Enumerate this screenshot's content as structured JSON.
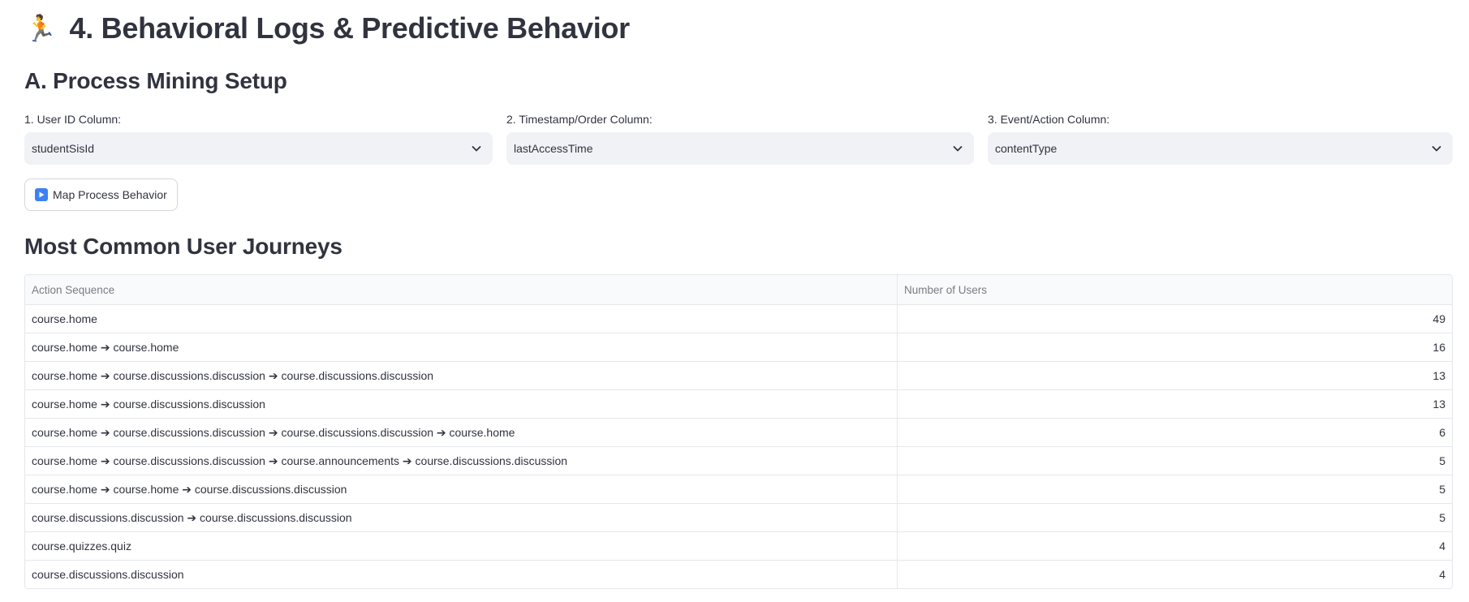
{
  "header": {
    "icon": "person-walking-icon",
    "emoji": "🏃",
    "title": "4. Behavioral Logs & Predictive Behavior"
  },
  "setup": {
    "section_title": "A. Process Mining Setup",
    "fields": [
      {
        "label": "1. User ID Column:",
        "value": "studentSisId"
      },
      {
        "label": "2. Timestamp/Order Column:",
        "value": "lastAccessTime"
      },
      {
        "label": "3. Event/Action Column:",
        "value": "contentType"
      }
    ],
    "button_label": "Map Process Behavior",
    "button_icon": "play-button-icon"
  },
  "journeys": {
    "section_title": "Most Common User Journeys",
    "columns": [
      "Action Sequence",
      "Number of Users"
    ],
    "rows": [
      {
        "sequence": "course.home",
        "users": "49"
      },
      {
        "sequence": "course.home ➔ course.home",
        "users": "16"
      },
      {
        "sequence": "course.home ➔ course.discussions.discussion ➔ course.discussions.discussion",
        "users": "13"
      },
      {
        "sequence": "course.home ➔ course.discussions.discussion",
        "users": "13"
      },
      {
        "sequence": "course.home ➔ course.discussions.discussion ➔ course.discussions.discussion ➔ course.home",
        "users": "6"
      },
      {
        "sequence": "course.home ➔ course.discussions.discussion ➔ course.announcements ➔ course.discussions.discussion",
        "users": "5"
      },
      {
        "sequence": "course.home ➔ course.home ➔ course.discussions.discussion",
        "users": "5"
      },
      {
        "sequence": "course.discussions.discussion ➔ course.discussions.discussion",
        "users": "5"
      },
      {
        "sequence": "course.quizzes.quiz",
        "users": "4"
      },
      {
        "sequence": "course.discussions.discussion",
        "users": "4"
      }
    ]
  },
  "colors": {
    "text": "#31333f",
    "select_bg": "#f0f2f6",
    "border": "#e6e7ea",
    "header_text": "#7a7c85",
    "play_icon": "#3b82f6"
  }
}
